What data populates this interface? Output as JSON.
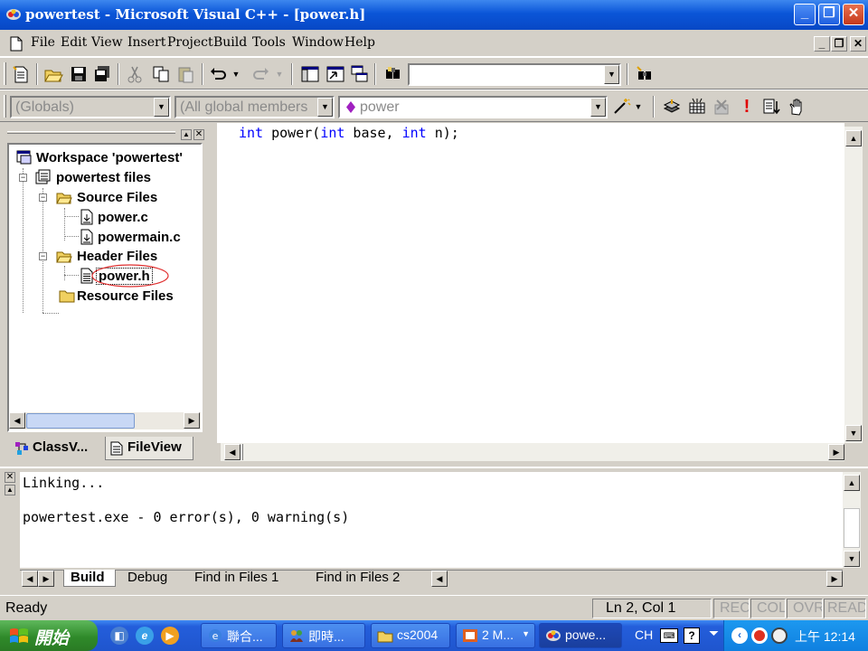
{
  "window": {
    "title": "powertest - Microsoft Visual C++ - [power.h]",
    "controls": {
      "minimize": "_",
      "maximize": "❐",
      "close": "✕"
    }
  },
  "menu": {
    "items": [
      "File",
      "Edit",
      "View",
      "Insert",
      "Project",
      "Build",
      "Tools",
      "Window",
      "Help"
    ],
    "mdi_controls": [
      "_",
      "❐",
      "✕"
    ]
  },
  "toolbar1": {
    "find_combo_value": ""
  },
  "toolbar2": {
    "class_combo": "(Globals)",
    "members_combo": "(All global members",
    "function_combo": "power"
  },
  "workspace": {
    "tree": {
      "root": "Workspace 'powertest'",
      "project": "powertest files",
      "source_folder": "Source Files",
      "source_files": [
        "power.c",
        "powermain.c"
      ],
      "header_folder": "Header Files",
      "header_files": [
        "power.h"
      ],
      "resource_folder": "Resource Files"
    },
    "tabs": [
      "ClassV...",
      "FileView"
    ],
    "active_tab": "FileView"
  },
  "editor": {
    "line1": {
      "kw1": "int",
      "t1": " power(",
      "kw2": "int",
      "t2": " base, ",
      "kw3": "int",
      "t3": " n);"
    }
  },
  "output": {
    "lines": [
      "Linking...",
      "",
      "powertest.exe - 0 error(s), 0 warning(s)"
    ],
    "tabs": [
      "Build",
      "Debug",
      "Find in Files 1",
      "Find in Files 2"
    ],
    "active_tab": "Build"
  },
  "status": {
    "message": "Ready",
    "position": "Ln 2, Col 1",
    "indicators": [
      "REC",
      "COL",
      "OVR",
      "READ"
    ]
  },
  "taskbar": {
    "start_label": "開始",
    "tasks": [
      "聯合...",
      "即時...",
      "cs2004",
      "2 M...",
      "powe..."
    ],
    "active_task": "powe...",
    "language": "CH",
    "clock": "上午 12:14"
  },
  "colors": {
    "keyword": "#0000ff",
    "titlebar": "#0a55d8",
    "annotation_circle": "#e03030"
  }
}
